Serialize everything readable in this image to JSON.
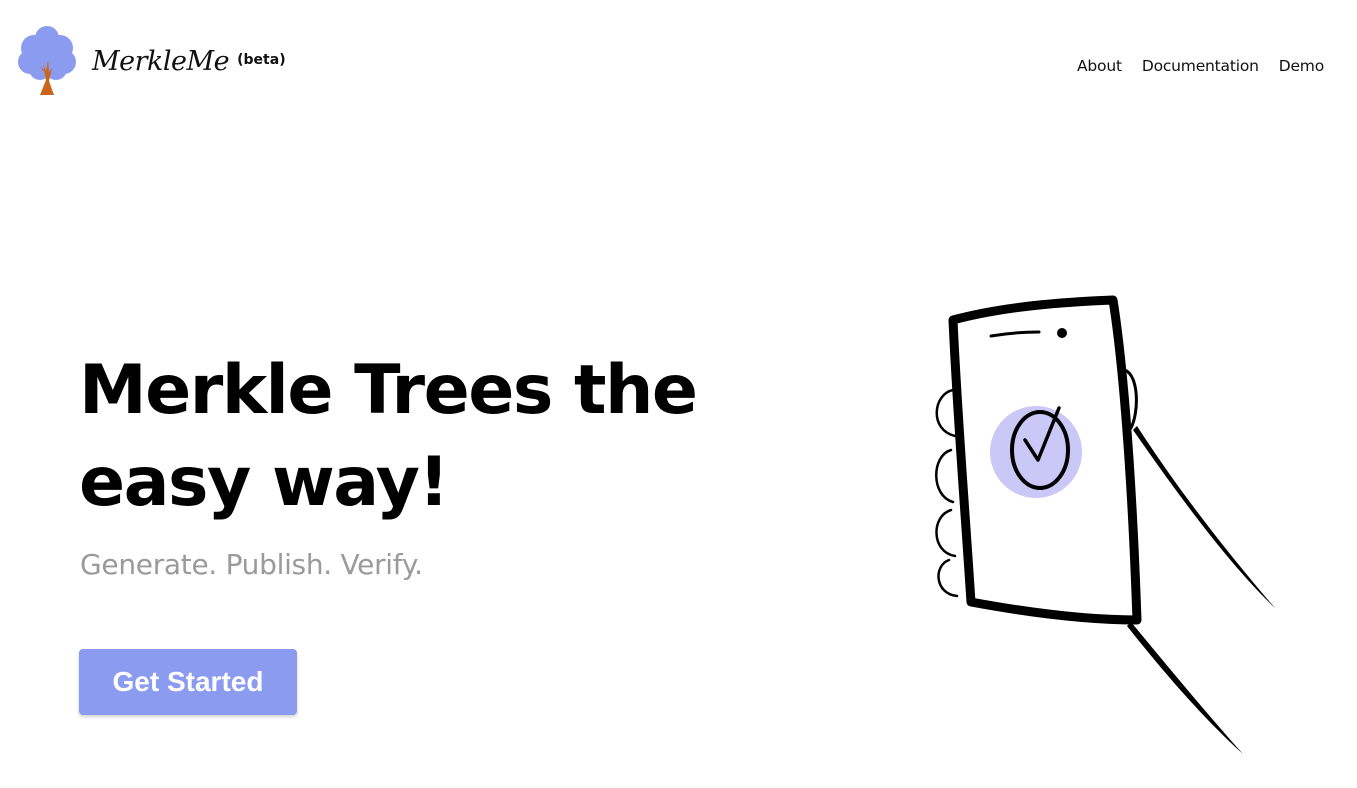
{
  "header": {
    "brand_name": "MerkleMe",
    "brand_badge": "(beta)",
    "logo_icon": "tree-icon",
    "nav": [
      {
        "label": "About"
      },
      {
        "label": "Documentation"
      },
      {
        "label": "Demo"
      }
    ]
  },
  "hero": {
    "title": "Merkle Trees the easy way!",
    "subtitle": "Generate. Publish. Verify.",
    "cta_label": "Get Started",
    "illustration_icon": "phone-checkmark-illustration"
  },
  "colors": {
    "accent": "#8b9cf0",
    "subtitle_gray": "#9a9a9a",
    "check_circle": "#c9c8f7",
    "tree_trunk": "#c9651c"
  }
}
